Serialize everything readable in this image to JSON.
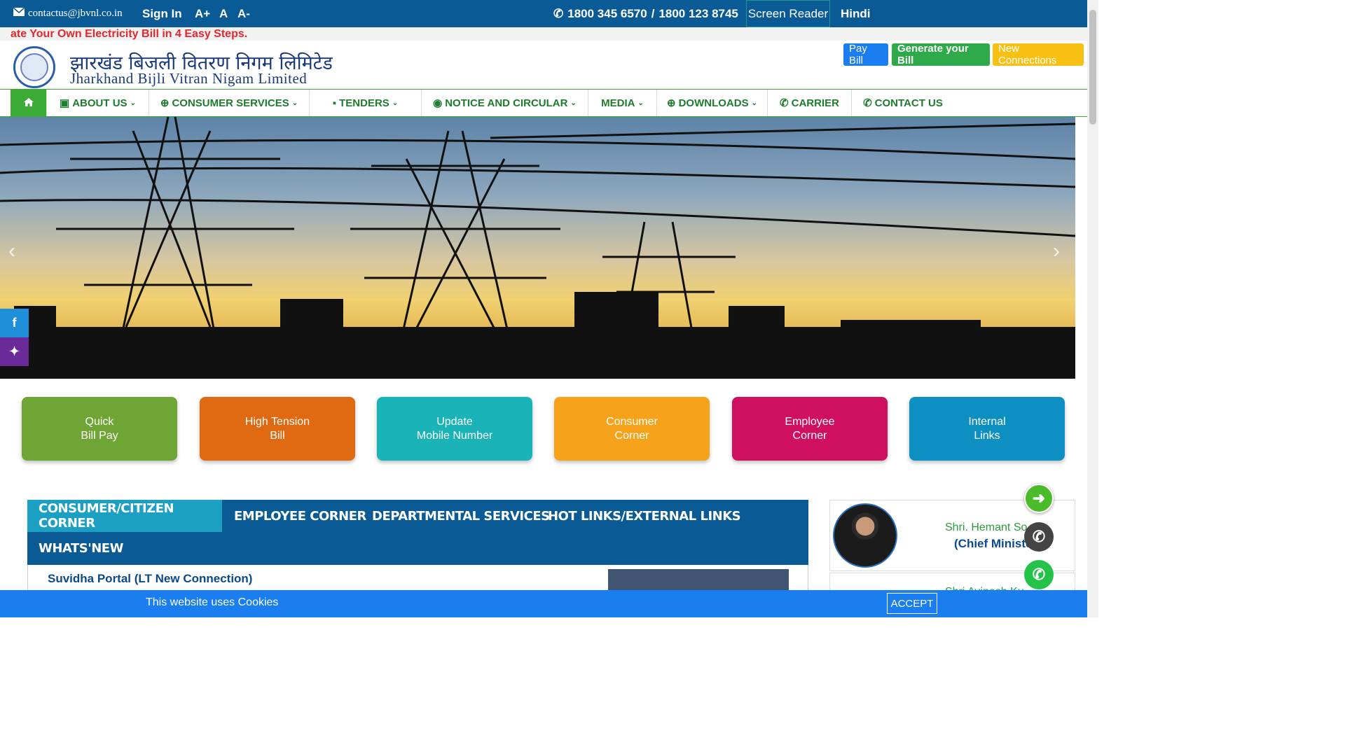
{
  "topbar": {
    "email": "contactus@jbvnl.co.in",
    "signin": "Sign In",
    "font_plus": "A+",
    "font_normal": "A",
    "font_minus": "A-",
    "phone1": "1800 345 6570",
    "phone_sep": "/",
    "phone2": "1800 123 8745",
    "screen_reader": "Screen Reader",
    "language": "Hindi"
  },
  "ticker": {
    "text": "ate Your Own Electricity Bill in 4 Easy Steps."
  },
  "brand": {
    "name_hindi": "झारखंड बिजली वितरण निगम लिमिटेड",
    "name_english": "Jharkhand Bijli Vitran Nigam Limited"
  },
  "header_buttons": {
    "pay_bill": "Pay Bill",
    "generate_bill": "Generate your Bill",
    "new_connections": "New Connections"
  },
  "nav": {
    "about": "ABOUT US",
    "consumer": "CONSUMER SERVICES",
    "tenders": "TENDERS",
    "notice": "NOTICE AND CIRCULAR",
    "media": "MEDIA",
    "downloads": "DOWNLOADS",
    "carrier": "CARRIER",
    "contact": "CONTACT US"
  },
  "tiles": [
    {
      "label": "Quick\nBill Pay",
      "color": "#6fa534"
    },
    {
      "label": "High Tension\nBill",
      "color": "#e06a12"
    },
    {
      "label": "Update\nMobile Number",
      "color": "#19b3b8"
    },
    {
      "label": "Consumer\nCorner",
      "color": "#f7a21b"
    },
    {
      "label": "Employee\nCorner",
      "color": "#cf1060"
    },
    {
      "label": "Internal\nLinks",
      "color": "#0e8fc2"
    }
  ],
  "tabs": {
    "consumer_citizen": "CONSUMER/CITIZEN CORNER",
    "employee": "EMPLOYEE CORNER",
    "departmental": "DEPARTMENTAL SERVICES",
    "hotlinks": "HOT LINKS/EXTERNAL LINKS",
    "whatsnew": "WHATS'NEW"
  },
  "tab_content": {
    "first_link": "Suvidha Portal (LT New Connection)"
  },
  "officials": {
    "first_name": "Shri. Hemant So",
    "first_title": "(Chief Ministe",
    "second_name": "Shri Avinash Ku"
  },
  "cookie": {
    "message": "This website uses Cookies",
    "accept": "ACCEPT"
  }
}
